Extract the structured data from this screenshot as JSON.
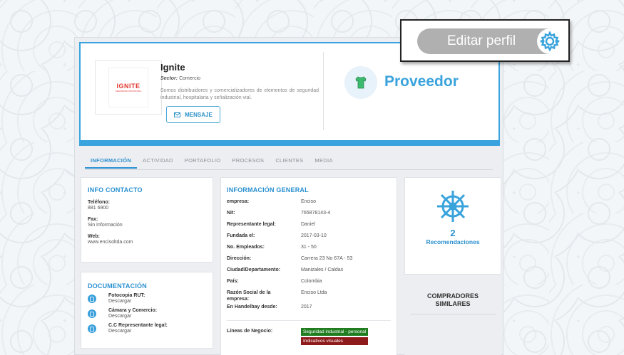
{
  "header": {
    "logo": {
      "text": "IGNITE",
      "subtext": "SEGURIDAD INDUSTRIAL"
    },
    "company_name": "Ignite",
    "sector_label": "Sector:",
    "sector_value": "Comercio",
    "description": "Somos distribuidores y comercializadores de elementos de seguridad industrial, hospitalaria y señalización vial.",
    "message_button": "MENSAJE",
    "role": "Proveedor"
  },
  "tabs": [
    "INFORMACIÓN",
    "ACTIVIDAD",
    "PORTAFOLIO",
    "PROCESOS",
    "CLIENTES",
    "MEDIA"
  ],
  "contact": {
    "title": "INFO CONTACTO",
    "items": [
      {
        "label": "Teléfono:",
        "value": "881 6900"
      },
      {
        "label": "Fax:",
        "value": "Sin Información"
      },
      {
        "label": "Web:",
        "value": "www.encisoltda.com"
      }
    ]
  },
  "documents": {
    "title": "DOCUMENTACIÓN",
    "items": [
      {
        "name": "Fotocopia RUT:",
        "link": "Descargar"
      },
      {
        "name": "Cámara y Comercio:",
        "link": "Descargar"
      },
      {
        "name": "C.C Representante legal:",
        "link": "Descargar"
      }
    ]
  },
  "general": {
    "title": "INFORMACIÓN GENERAL",
    "rows": [
      {
        "label": "empresa:",
        "value": "Enciso"
      },
      {
        "label": "Nit:",
        "value": "765878143-4"
      },
      {
        "label": "Representante legal:",
        "value": "Daniel"
      },
      {
        "label": "Fundada el:",
        "value": "2017-03-10"
      },
      {
        "label": "No. Empleados:",
        "value": "31 - 50"
      },
      {
        "label": "Dirección:",
        "value": "Carrera 23 No 67A - 53"
      },
      {
        "label": "Ciudad/Departamento:",
        "value": "Manizales / Caldas"
      },
      {
        "label": "País:",
        "value": "Colombia"
      },
      {
        "label": "Razón Social de la empresa:",
        "value": "Enciso Ltda"
      },
      {
        "label": "En Handelbay desde:",
        "value": "2017"
      }
    ],
    "business_lines_label": "Líneas de Negocio:",
    "business_lines": [
      "Seguridad industrial - personal",
      "Indicativos visuales"
    ]
  },
  "recommendations": {
    "count": "2",
    "label": "Recomendaciones"
  },
  "similar_buyers": {
    "title_line1": "COMPRADORES",
    "title_line2": "SIMILARES"
  },
  "callout": {
    "label": "Editar perfil"
  },
  "colors": {
    "accent": "#39a3e0",
    "tag_green": "#1f7d1f",
    "tag_red": "#8e1b1b"
  }
}
